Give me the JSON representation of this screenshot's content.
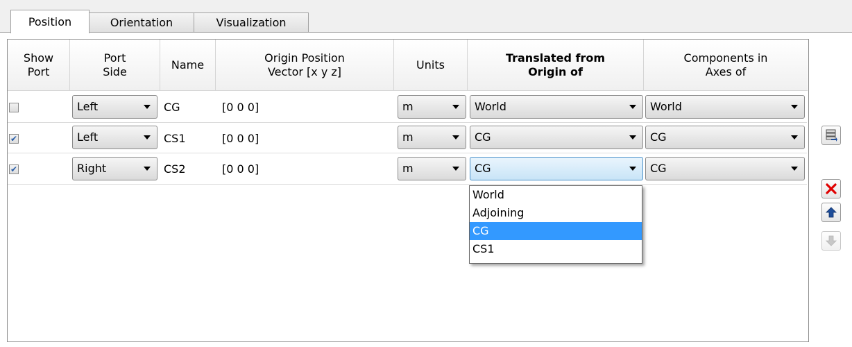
{
  "tabs": [
    "Position",
    "Orientation",
    "Visualization"
  ],
  "active_tab": "Position",
  "table": {
    "headers": [
      "Show\nPort",
      "Port\nSide",
      "Name",
      "Origin Position\nVector [x y z]",
      "Units",
      "Translated from\nOrigin of",
      "Components in\nAxes of"
    ],
    "rows": [
      {
        "show_port": "",
        "port_side": "Left",
        "name": "CG",
        "origin": "[0 0 0]",
        "units": "m",
        "translated_from": "World",
        "components_in": "World"
      },
      {
        "show_port": "✔",
        "port_side": "Left",
        "name": "CS1",
        "origin": "[0 0 0]",
        "units": "m",
        "translated_from": "CG",
        "components_in": "CG"
      },
      {
        "show_port": "✔",
        "port_side": "Right",
        "name": "CS2",
        "origin": "[0 0 0]",
        "units": "m",
        "translated_from": "CG",
        "components_in": "CG"
      }
    ]
  },
  "dropdown": {
    "options": [
      "World",
      "Adjoining",
      "CG",
      "CS1"
    ],
    "selected": "CG"
  },
  "side_buttons": {
    "add_icon": "add-row-icon",
    "delete_icon": "delete-x-icon",
    "move_up_icon": "arrow-up-icon",
    "move_down_icon": "arrow-down-icon"
  },
  "colors": {
    "selection": "#3399ff",
    "delete_red": "#e00000",
    "arrow_blue": "#1f4e9a"
  }
}
